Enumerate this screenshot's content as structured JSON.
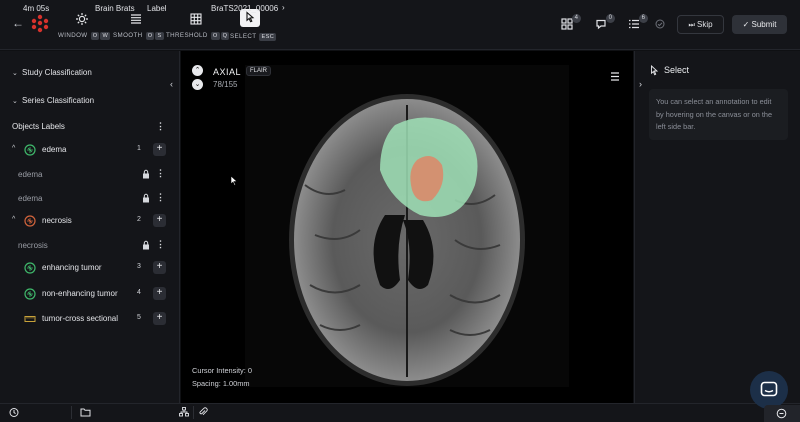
{
  "toolbar": {
    "tools": [
      {
        "label": "WINDOW",
        "keys": [
          "O",
          "W"
        ],
        "icon": "sun-icon"
      },
      {
        "label": "SMOOTH",
        "keys": [
          "O",
          "S"
        ],
        "icon": "smooth-icon"
      },
      {
        "label": "THRESHOLD",
        "keys": [
          "O",
          "Q"
        ],
        "icon": "grid-icon"
      },
      {
        "label": "SELECT",
        "keys": [
          "ESC"
        ],
        "icon": "pointer-icon"
      }
    ],
    "badges": {
      "grid": "4",
      "comments": "0",
      "list": "6"
    },
    "skip_label": "Skip",
    "submit_label": "Submit"
  },
  "sidebar": {
    "study_classification": "Study Classification",
    "series_classification": "Series Classification",
    "objects_labels": "Objects Labels",
    "labels": [
      {
        "name": "edema",
        "count": "1",
        "color": "#3fb86b",
        "instances": [
          "edema",
          "edema"
        ]
      },
      {
        "name": "necrosis",
        "count": "2",
        "color": "#d2643c",
        "instances": [
          "necrosis"
        ]
      },
      {
        "name": "enhancing tumor",
        "count": "3",
        "color": "#3fb86b",
        "instances": []
      },
      {
        "name": "non-enhancing tumor",
        "count": "4",
        "color": "#3fb86b",
        "instances": []
      },
      {
        "name": "tumor-cross sectional",
        "count": "5",
        "color": "#c8a23a",
        "instances": []
      }
    ]
  },
  "viewer": {
    "plane": "AXIAL",
    "sequence": "FLAIR",
    "slice": "78/155",
    "cursor_intensity": "Cursor Intensity: 0",
    "spacing": "Spacing: 1.00mm"
  },
  "right_panel": {
    "title": "Select",
    "help_text": "You can select an annotation to edit by hovering on the canvas or on the left side bar."
  },
  "bottom": {
    "timer": "4m 05s",
    "project": "Brain Brats",
    "mode": "Label",
    "file": "BraTS2021_00006"
  }
}
